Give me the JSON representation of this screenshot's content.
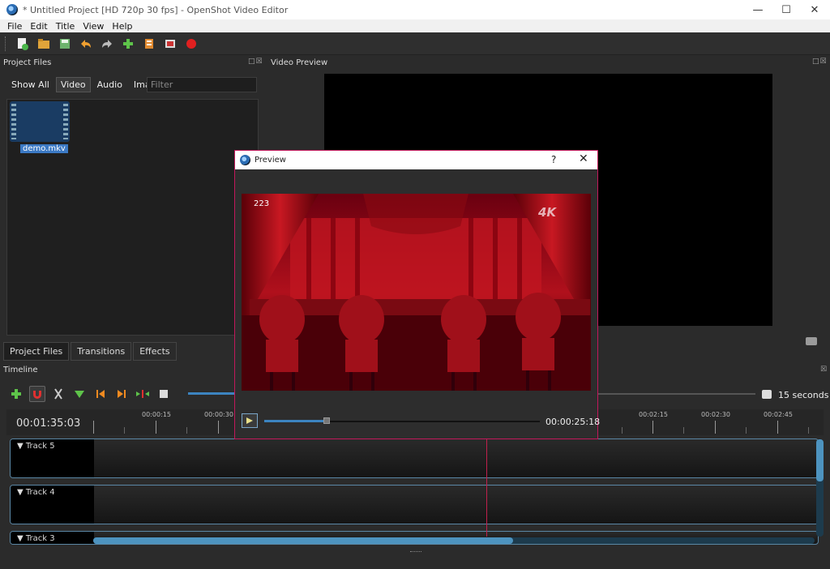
{
  "window": {
    "title": "* Untitled Project [HD 720p 30 fps] - OpenShot Video Editor"
  },
  "menu": [
    "File",
    "Edit",
    "Title",
    "View",
    "Help"
  ],
  "project_files": {
    "title": "Project Files",
    "filters": [
      "Show All",
      "Video",
      "Audio",
      "Image"
    ],
    "active_filter": "Video",
    "filter_placeholder": "Filter",
    "files": [
      {
        "name": "demo.mkv"
      }
    ],
    "tabs": [
      "Project Files",
      "Transitions",
      "Effects"
    ]
  },
  "video_preview": {
    "title": "Video Preview"
  },
  "timeline": {
    "title": "Timeline",
    "timecode": "00:01:35:03",
    "zoom_label": "15 seconds",
    "ticks": [
      "00:00:15",
      "00:00:30",
      "00:02:15",
      "00:02:30",
      "00:02:45"
    ],
    "tracks": [
      "Track 5",
      "Track 4",
      "Track 3"
    ]
  },
  "preview_dialog": {
    "title": "Preview",
    "help": "?",
    "close": "✕",
    "frame_number": "223",
    "badge": "4K",
    "time": "00:00:25:18",
    "progress": 0.22
  },
  "colors": {
    "accent": "#3c84c0",
    "playhead": "#c0204c",
    "dialog_border": "#c2185b"
  }
}
